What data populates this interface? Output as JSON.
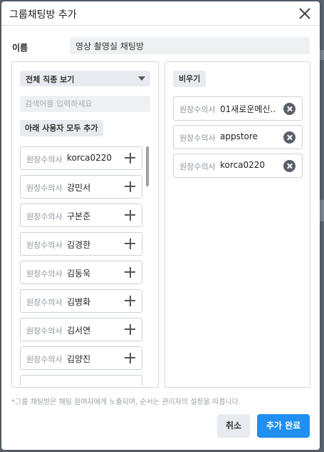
{
  "dialog": {
    "title": "그룹채팅방 추가",
    "close_icon": "close-icon"
  },
  "name": {
    "label": "이름",
    "value": "영상 촬영실 채팅방"
  },
  "left_panel": {
    "job_filter": "전체 직종 보기",
    "search_placeholder": "검색어를 입력하세요",
    "add_all_label": "아래 사용자 모두 추가",
    "users": [
      {
        "role": "원장수의사",
        "name": "korca0220"
      },
      {
        "role": "원장수의사",
        "name": "강민서"
      },
      {
        "role": "원장수의사",
        "name": "구본준"
      },
      {
        "role": "원장수의사",
        "name": "김경한"
      },
      {
        "role": "원장수의사",
        "name": "김동욱"
      },
      {
        "role": "원장수의사",
        "name": "김병화"
      },
      {
        "role": "원장수의사",
        "name": "김서연"
      },
      {
        "role": "원장수의사",
        "name": "김양진"
      },
      {
        "role": "",
        "name": ""
      }
    ]
  },
  "right_panel": {
    "clear_label": "비우기",
    "selected": [
      {
        "role": "원장수의사",
        "name": "01새로운메신..."
      },
      {
        "role": "원장수의사",
        "name": "appstore"
      },
      {
        "role": "원장수의사",
        "name": "korca0220"
      }
    ]
  },
  "footer": {
    "notice": "*그룹 채팅방은 채팅 참여자에게 노출되며, 순서는 관리자의 설정을 따릅니다.",
    "cancel_label": "취소",
    "confirm_label": "추가 완료"
  },
  "colors": {
    "accent": "#1f8ff0",
    "field_bg": "#eef1f4",
    "border": "#ccd1d6"
  }
}
